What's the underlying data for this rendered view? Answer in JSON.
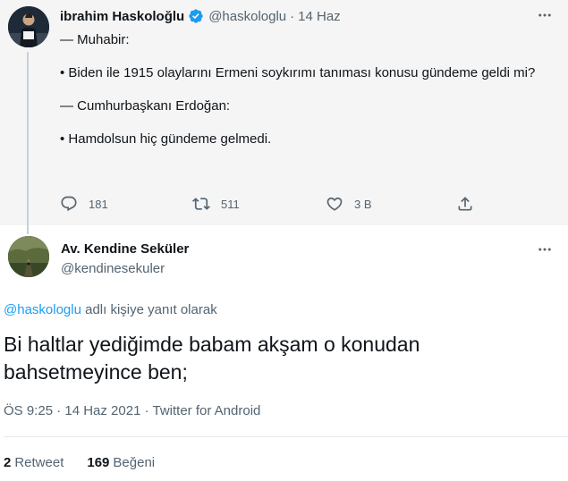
{
  "parent_tweet": {
    "author_name": "ibrahim Haskoloğlu",
    "handle": "@haskologlu",
    "separator": "·",
    "date": "14 Haz",
    "verified": true,
    "more_icon": "ellipsis-icon",
    "lines": [
      "— Muhabir:",
      "",
      "• Biden ile 1915 olaylarını Ermeni soykırımı tanıması konusu gündeme geldi mi?",
      "",
      "— Cumhurbaşkanı Erdoğan:",
      "",
      "• Hamdolsun hiç gündeme gelmedi."
    ],
    "actions": {
      "reply_count": "181",
      "retweet_count": "511",
      "like_count": "3 B"
    }
  },
  "reply_tweet": {
    "author_name": "Av. Kendine Seküler",
    "handle": "@kendinesekuler",
    "replying_to_handle": "@haskologlu",
    "replying_to_suffix": " adlı kişiye yanıt olarak",
    "text": "Bi haltlar yediğimde babam akşam o konudan bahsetmeyince ben;",
    "timestamp": "ÖS 9:25 · 14 Haz 2021 · Twitter for Android",
    "stats": {
      "retweet_count": "2",
      "retweet_label": "Retweet",
      "like_count": "169",
      "like_label": "Beğeni"
    }
  },
  "colors": {
    "accent": "#1d9bf0",
    "secondary_text": "#536471",
    "parent_background": "#f5f5f5"
  }
}
